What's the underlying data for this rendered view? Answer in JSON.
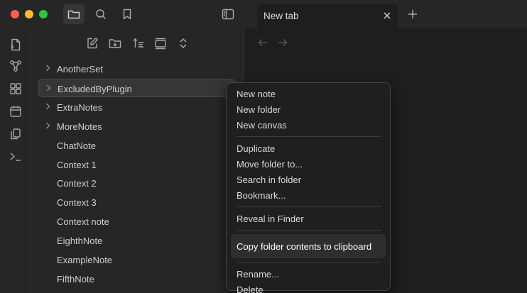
{
  "titlebar": {
    "tab": {
      "title": "New tab"
    },
    "icons": [
      "folder-icon",
      "search-icon",
      "bookmark-icon",
      "sidebar-toggle-icon",
      "close-icon",
      "plus-icon"
    ]
  },
  "ribbon": {
    "icons": [
      "open-quick-switcher-icon",
      "graph-view-icon",
      "canvas-icon",
      "daily-note-icon",
      "templates-icon",
      "command-palette-icon"
    ]
  },
  "explorer": {
    "toolbar": [
      "new-note-icon",
      "new-folder-icon",
      "sort-icon",
      "collapse-all-icon",
      "expand-icon"
    ],
    "items": [
      {
        "label": "AnotherSet",
        "folder": true
      },
      {
        "label": "ExcludedByPlugin",
        "folder": true,
        "selected": true
      },
      {
        "label": "ExtraNotes",
        "folder": true
      },
      {
        "label": "MoreNotes",
        "folder": true
      },
      {
        "label": "ChatNote",
        "folder": false
      },
      {
        "label": "Context 1",
        "folder": false
      },
      {
        "label": "Context 2",
        "folder": false
      },
      {
        "label": "Context 3",
        "folder": false
      },
      {
        "label": "Context note",
        "folder": false
      },
      {
        "label": "EighthNote",
        "folder": false
      },
      {
        "label": "ExampleNote",
        "folder": false
      },
      {
        "label": "FifthNote",
        "folder": false
      }
    ]
  },
  "context_menu": {
    "groups": [
      [
        "New note",
        "New folder",
        "New canvas"
      ],
      [
        "Duplicate",
        "Move folder to...",
        "Search in folder",
        "Bookmark..."
      ],
      [
        "Reveal in Finder"
      ],
      [
        "Copy folder contents to clipboard"
      ],
      [
        "Rename...",
        "Delete"
      ]
    ],
    "highlighted": "Copy folder contents to clipboard"
  },
  "colors": {
    "accent": "#ff5f57",
    "background": "#1e1e1e",
    "sidebar": "#262626"
  }
}
